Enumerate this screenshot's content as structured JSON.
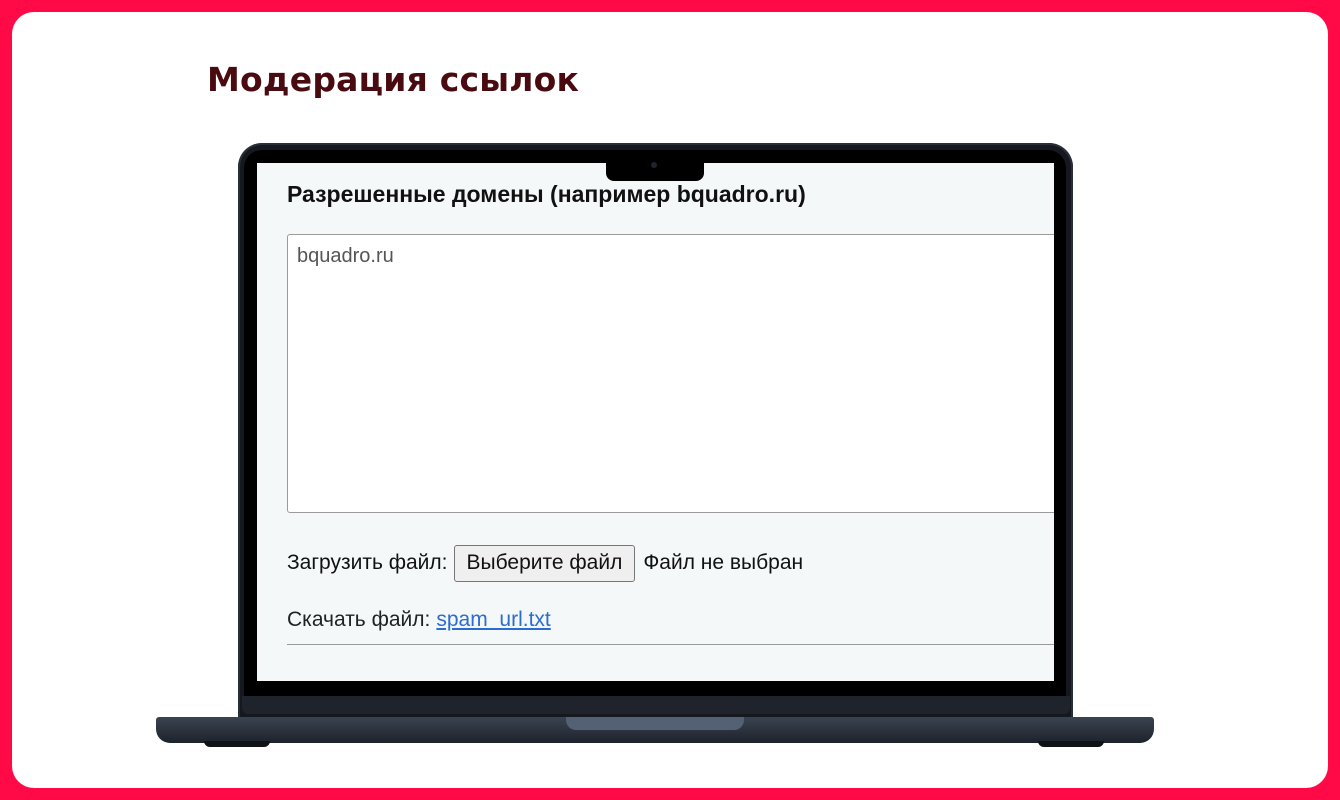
{
  "slide": {
    "title": "Модерация ссылок"
  },
  "form": {
    "heading": "Разрешенные домены (например bquadro.ru)",
    "textarea_value": "bquadro.ru",
    "upload_label": "Загрузить файл:",
    "file_button_label": "Выберите файл",
    "no_file_text": "Файл не выбран",
    "download_label": "Скачать файл:",
    "download_link": "spam_url.txt"
  },
  "colors": {
    "frame": "#ff0a47",
    "title": "#4a0b10",
    "link": "#2b6cd1"
  }
}
